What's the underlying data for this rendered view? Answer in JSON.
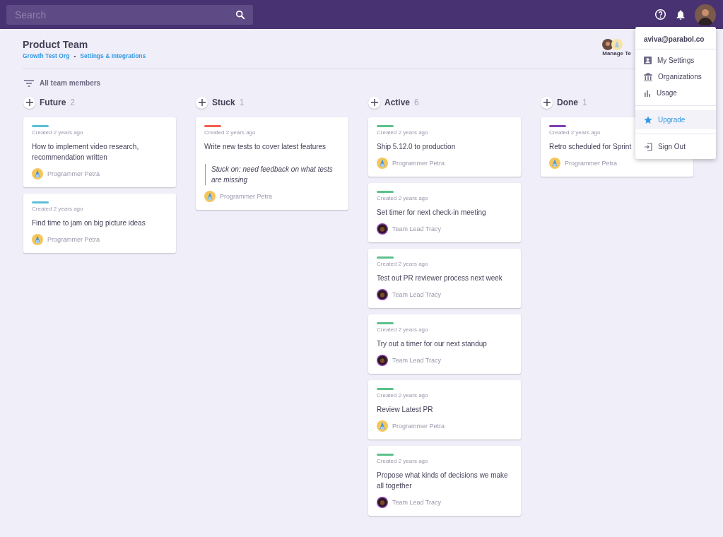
{
  "top_bar": {
    "search": {
      "placeholder": "Search"
    }
  },
  "header": {
    "title": "Product Team",
    "links": [
      "Growth Test Org",
      "Settings & Integrations"
    ],
    "separator": "•",
    "manage_team": "Manage Te"
  },
  "filter": {
    "label": "All team members"
  },
  "columns": [
    {
      "title": "Future",
      "count": "2",
      "cards": [
        {
          "color": "#5bc0d6",
          "created": "Created 2 years ago",
          "title": "How to implement video research, recommendation written",
          "assignee": {
            "name": "Programmer Petra",
            "kind": "robot"
          }
        },
        {
          "color": "#5bc0d6",
          "created": "Created 2 years ago",
          "title": "Find time to jam on big picture ideas",
          "assignee": {
            "name": "Programmer Petra",
            "kind": "robot"
          }
        }
      ]
    },
    {
      "title": "Stuck",
      "count": "1",
      "cards": [
        {
          "color": "#f25f4c",
          "created": "Created 2 years ago",
          "title": "Write new tests to cover latest features",
          "note": "Stuck on: need feedback on what tests are missing",
          "assignee": {
            "name": "Programmer Petra",
            "kind": "robot"
          }
        }
      ]
    },
    {
      "title": "Active",
      "count": "6",
      "cards": [
        {
          "color": "#5cc18c",
          "created": "Created 2 years ago",
          "title": "Ship 5.12.0 to production",
          "assignee": {
            "name": "Programmer Petra",
            "kind": "robot"
          }
        },
        {
          "color": "#5cc18c",
          "created": "Created 2 years ago",
          "title": "Set timer for next check-in meeting",
          "assignee": {
            "name": "Team Lead Tracy",
            "kind": "person"
          }
        },
        {
          "color": "#5cc18c",
          "created": "Created 2 years ago",
          "title": "Test out PR reviewer process next week",
          "assignee": {
            "name": "Team Lead Tracy",
            "kind": "person"
          }
        },
        {
          "color": "#5cc18c",
          "created": "Created 2 years ago",
          "title": "Try out a timer for our next standup",
          "assignee": {
            "name": "Team Lead Tracy",
            "kind": "person"
          }
        },
        {
          "color": "#5cc18c",
          "created": "Created 2 years ago",
          "title": "Review Latest PR",
          "assignee": {
            "name": "Programmer Petra",
            "kind": "robot"
          }
        },
        {
          "color": "#5cc18c",
          "created": "Created 2 years ago",
          "title": "Propose what kinds of decisions we make all together",
          "assignee": {
            "name": "Team Lead Tracy",
            "kind": "person"
          }
        }
      ]
    },
    {
      "title": "Done",
      "count": "1",
      "cards": [
        {
          "color": "#7d3fb0",
          "created": "Created 2 years ago",
          "title": "Retro scheduled for Sprint",
          "assignee": {
            "name": "Programmer Petra",
            "kind": "robot"
          }
        }
      ]
    }
  ],
  "user_menu": {
    "email": "aviva@parabol.co",
    "items": [
      {
        "label": "My Settings",
        "kind": "settings",
        "selected": false
      },
      {
        "label": "Organizations",
        "kind": "organizations",
        "selected": false
      },
      {
        "label": "Usage",
        "kind": "usage",
        "selected": false
      },
      {
        "label": "Upgrade",
        "kind": "upgrade",
        "selected": true
      },
      {
        "label": "Sign Out",
        "kind": "signout",
        "selected": false
      }
    ]
  }
}
